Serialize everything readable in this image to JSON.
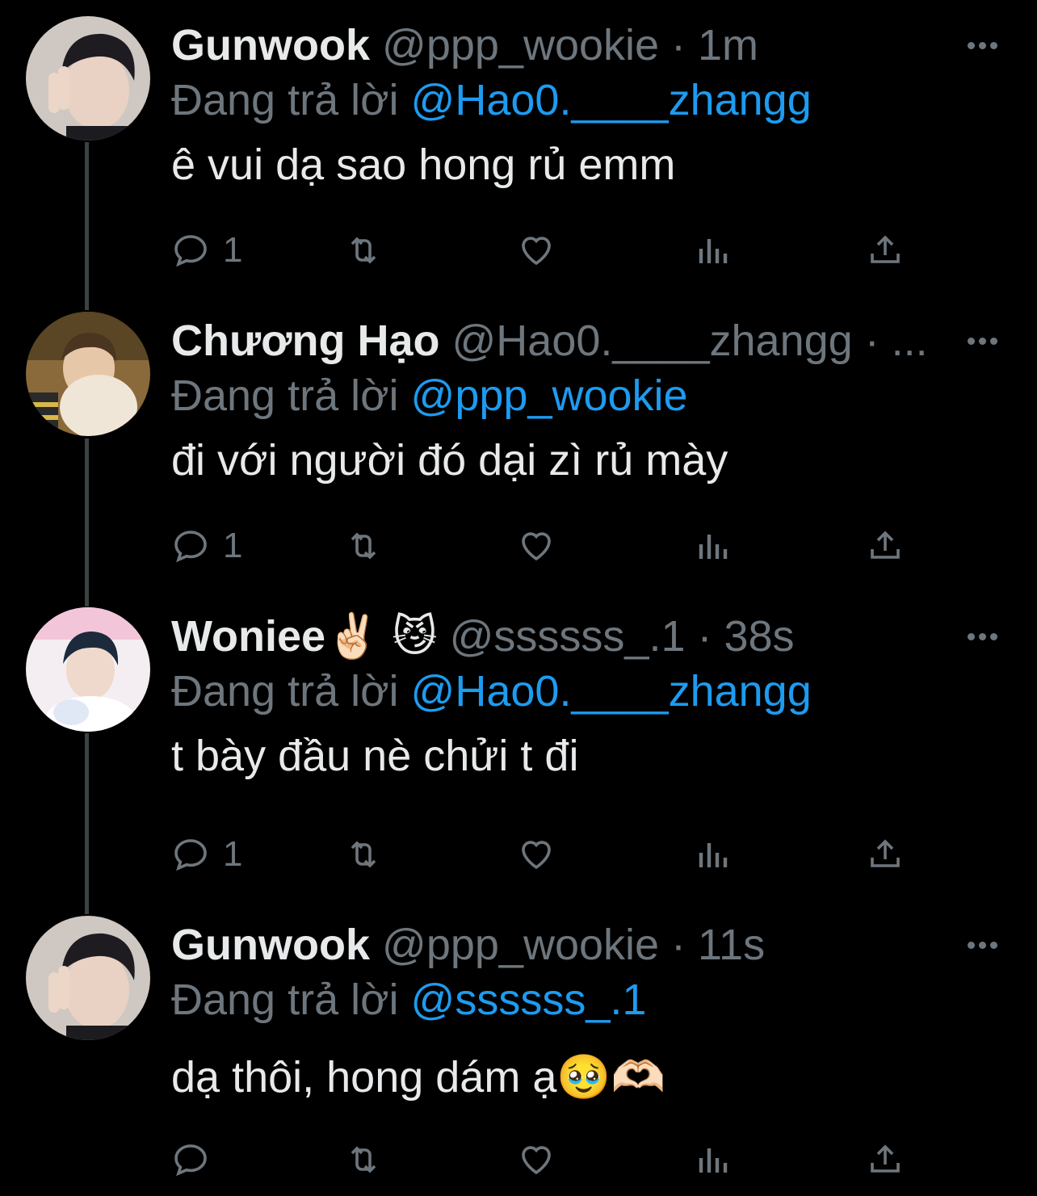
{
  "tweets": [
    {
      "name": "Gunwook",
      "handle": "@ppp_wookie · 1m",
      "reply_prefix": "Đang trả lời",
      "reply_to": "@Hao0.____zhangg",
      "text": "ê vui dạ sao hong rủ emm",
      "reply_count": "1"
    },
    {
      "name": "Chương Hạo",
      "handle": "@Hao0.____zhangg · ...",
      "reply_prefix": "Đang trả lời",
      "reply_to": "@ppp_wookie",
      "text": "đi với người đó dại zì rủ mày",
      "reply_count": "1"
    },
    {
      "name": "Woniee✌🏻 😼",
      "handle": "@ssssss_.1 · 38s",
      "reply_prefix": "Đang trả lời",
      "reply_to": "@Hao0.____zhangg",
      "text": "t bày đầu nè chửi t đi",
      "reply_count": "1"
    },
    {
      "name": "Gunwook",
      "handle": "@ppp_wookie · 11s",
      "reply_prefix": "Đang trả lời",
      "reply_to": "@ssssss_.1",
      "text": "dạ thôi, hong dám ạ🥹🫶🏻",
      "reply_count": ""
    }
  ],
  "icons": {
    "reply": "reply-icon",
    "retweet": "retweet-icon",
    "like": "heart-icon",
    "views": "analytics-icon",
    "share": "share-icon",
    "more": "more-icon"
  },
  "colors": {
    "background": "#000000",
    "text": "#e7e9ea",
    "muted": "#6e767d",
    "mention": "#1d9bf0",
    "thread_line": "#3e4144"
  }
}
